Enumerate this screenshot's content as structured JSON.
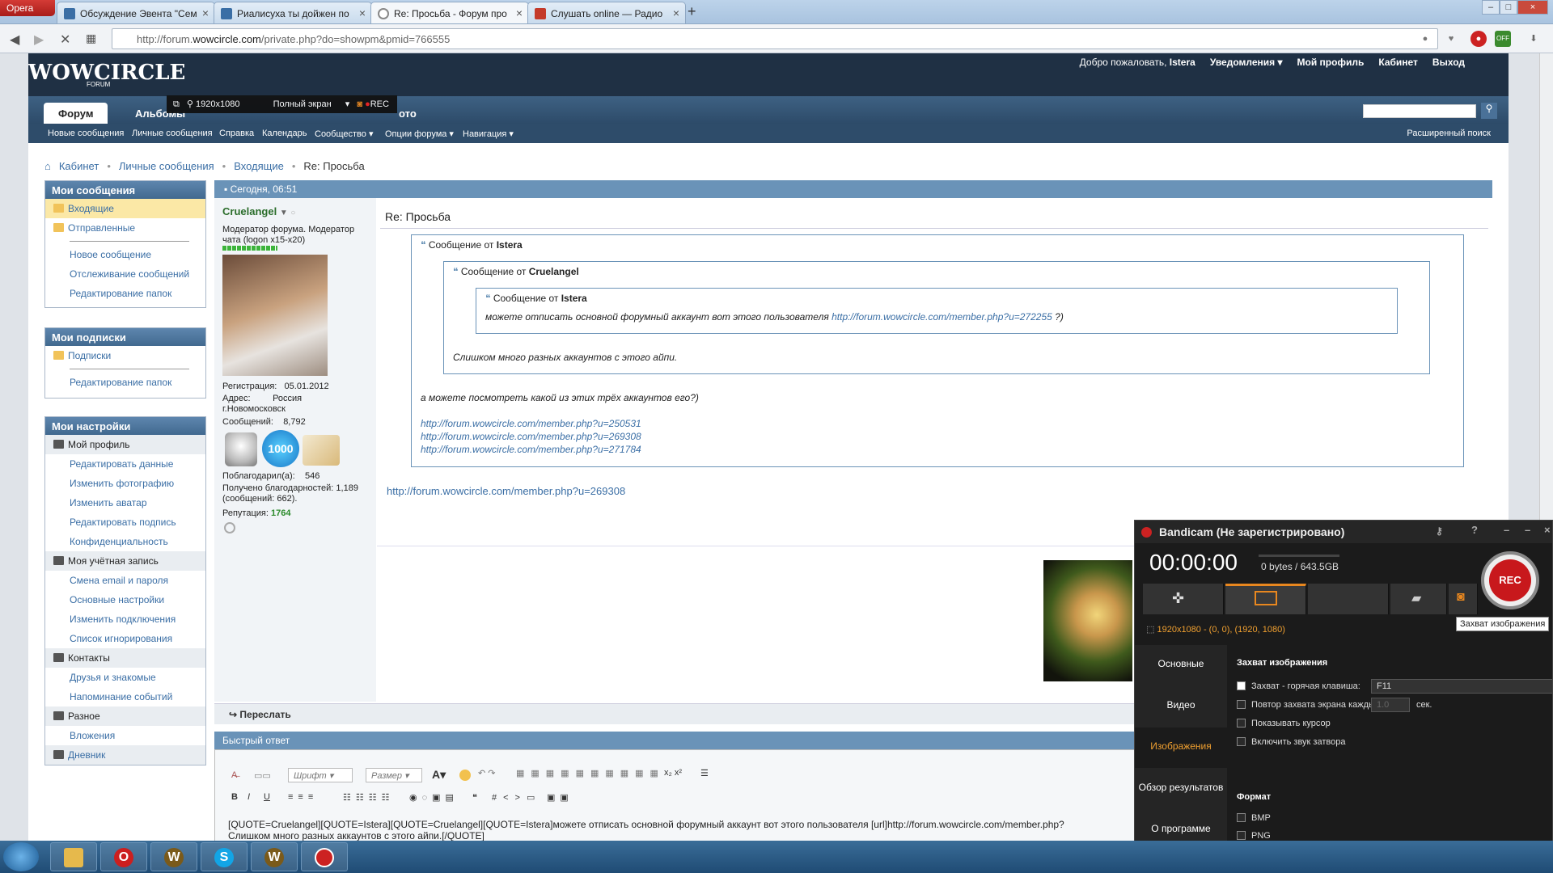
{
  "browser": {
    "opera_label": "Opera",
    "tabs": [
      {
        "title": "Обсуждение Эвента \"Сем",
        "color": "#3a6ea5"
      },
      {
        "title": "Риалисуха ты дойжен по",
        "color": "#3a6ea5"
      },
      {
        "title": "Re: Просьба - Форум про",
        "color": "#888888"
      },
      {
        "title": "Слушать online — Радио",
        "color": "#c43a2a"
      }
    ],
    "url_prefix": "http://forum.",
    "url_domain": "wowcircle.com",
    "url_path": "/private.php?do=showpm&pmid=766555"
  },
  "forum": {
    "logo": "WOWCIRCLE",
    "logo_sub": "FORUM",
    "top_links": {
      "welcome": "Добро пожаловать,",
      "user": "Istera",
      "notifications": "Уведомления ▾",
      "profile": "Мой профиль",
      "cabinet": "Кабинет",
      "logout": "Выход"
    },
    "nav_tabs": [
      "Форум",
      "Альбомы",
      "ото"
    ],
    "subnav": [
      "Новые сообщения",
      "Личные сообщения",
      "Справка",
      "Календарь",
      "Сообщество ▾",
      "Опции форума ▾",
      "Навигация ▾"
    ],
    "adv_search": "Расширенный поиск",
    "bandibar": {
      "res": "1920x1080",
      "mode": "Полный экран",
      "rec": "REC"
    },
    "breadcrumb": [
      "Кабинет",
      "Личные сообщения",
      "Входящие",
      "Re: Просьба"
    ]
  },
  "sidebar": {
    "messages_title": "Мои сообщения",
    "messages": [
      {
        "label": "Входящие",
        "type": "hl"
      },
      {
        "label": "Отправленные",
        "type": "folder"
      },
      {
        "label": "Новое сообщение",
        "type": "ind"
      },
      {
        "label": "Отслеживание сообщений",
        "type": "ind"
      },
      {
        "label": "Редактирование папок",
        "type": "ind"
      }
    ],
    "subs_title": "Мои подписки",
    "subs": [
      {
        "label": "Подписки",
        "type": "folder"
      },
      {
        "label": "Редактирование папок",
        "type": "ind"
      }
    ],
    "settings_title": "Мои настройки",
    "settings": [
      {
        "label": "Мой профиль",
        "type": "grp"
      },
      {
        "label": "Редактировать данные",
        "type": "ind"
      },
      {
        "label": "Изменить фотографию",
        "type": "ind"
      },
      {
        "label": "Изменить аватар",
        "type": "ind"
      },
      {
        "label": "Редактировать подпись",
        "type": "ind"
      },
      {
        "label": "Конфиденциальность",
        "type": "ind"
      },
      {
        "label": "Моя учётная запись",
        "type": "grp"
      },
      {
        "label": "Смена email и пароля",
        "type": "ind"
      },
      {
        "label": "Основные настройки",
        "type": "ind"
      },
      {
        "label": "Изменить подключения",
        "type": "ind"
      },
      {
        "label": "Список игнорирования",
        "type": "ind"
      },
      {
        "label": "Контакты",
        "type": "grp"
      },
      {
        "label": "Друзья и знакомые",
        "type": "ind"
      },
      {
        "label": "Напоминание событий",
        "type": "ind"
      },
      {
        "label": "Разное",
        "type": "grp"
      },
      {
        "label": "Вложения",
        "type": "ind"
      },
      {
        "label": "Дневник",
        "type": "grp"
      }
    ]
  },
  "post": {
    "date": "Сегодня, 06:51",
    "author": "Cruelangel",
    "rank": "Модератор форума. Модератор чата (logon x15-x20)",
    "reg_label": "Регистрация:",
    "reg": "05.01.2012",
    "addr_label": "Адрес:",
    "addr": "Россия г.Новомосковск",
    "msgs_label": "Сообщений:",
    "msgs": "8,792",
    "badge": "1000",
    "thanked_label": "Поблагодарил(а):",
    "thanked": "546",
    "got_thanks": "Получено благодарностей: 1,189 (сообщений: 662).",
    "rep_label": "Репутация:",
    "rep": "1764",
    "title": "Re: Просьба",
    "q1_from": "Сообщение от",
    "q1_user": "Istera",
    "q2_from": "Сообщение от",
    "q2_user": "Cruelangel",
    "q3_from": "Сообщение от",
    "q3_user": "Istera",
    "q3_text": "можете отписать основной форумный аккаунт вот этого пользователя",
    "q3_link": "http://forum.wowcircle.com/member.php?u=272255",
    "q3_tail": " ?)",
    "q2_text": "Слишком много разных аккаунтов с этого айпи.",
    "q1_text": "а можете посмотреть какой из этих трёх аккаунтов его?)",
    "q1_links": [
      "http://forum.wowcircle.com/member.php?u=250531",
      "http://forum.wowcircle.com/member.php?u=269308",
      "http://forum.wowcircle.com/member.php?u=271784"
    ],
    "answer_link": "http://forum.wowcircle.com/member.php?u=269308",
    "forward": "Переслать"
  },
  "quick_reply": {
    "title": "Быстрый ответ",
    "font": "Шрифт",
    "size": "Размер",
    "text_line1": "[QUOTE=Cruelangel][QUOTE=Istera][QUOTE=Cruelangel][QUOTE=Istera]можете отписать основной форумный аккаунт вот этого пользователя [url]http://forum.wowcircle.com/member.php?",
    "text_line2": "Слишком много разных аккаунтов с этого айпи.[/QUOTE]"
  },
  "bandicam": {
    "title": "Bandicam (Не зарегистрировано)",
    "time": "00:00:00",
    "size": "0 bytes / 643.5GB",
    "rec": "REC",
    "mode": "1920x1080 - (0, 0), (1920, 1080)",
    "tooltip": "Захват изображения",
    "side": [
      "Основные",
      "Видео",
      "Изображения",
      "Обзор результатов",
      "О программе"
    ],
    "section": "Захват изображения",
    "opt_hotkey": "Захват - горячая клавиша:",
    "hotkey": "F11",
    "opt_repeat": "Повтор захвата экрана каждые",
    "repeat_val": "1.0",
    "repeat_unit": "сек.",
    "opt_cursor": "Показывать курсор",
    "opt_sound": "Включить звук затвора",
    "format": "Формат",
    "fmt1": "BMP",
    "fmt2": "PNG"
  }
}
